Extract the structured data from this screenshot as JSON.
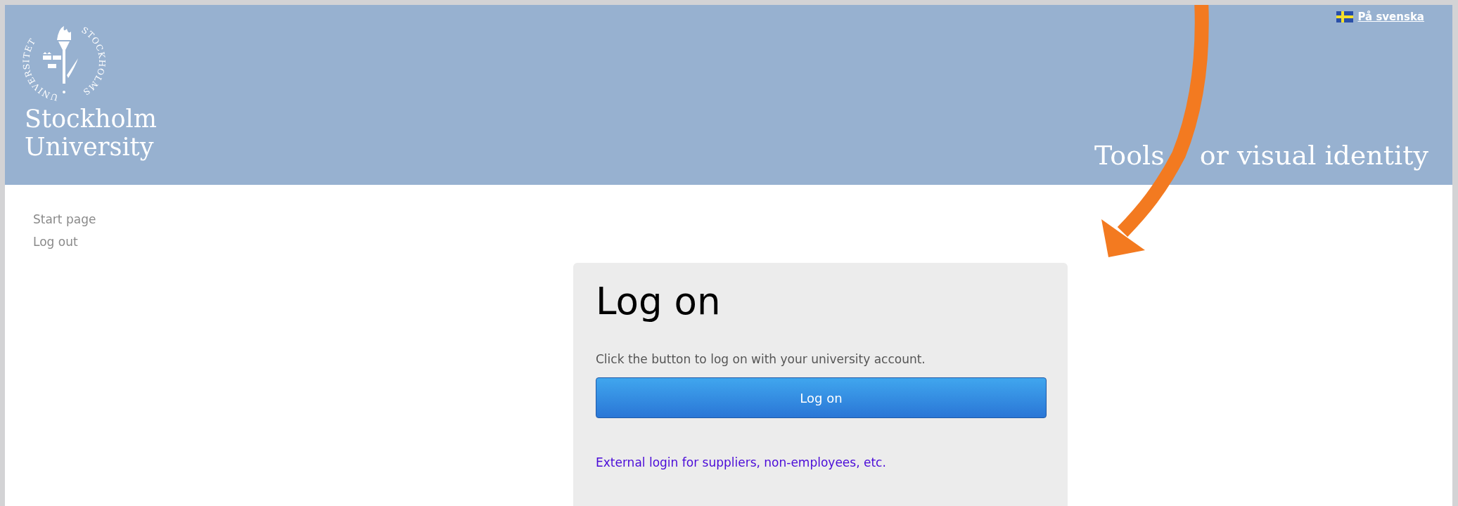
{
  "header": {
    "seal_text": [
      "UNIVERSITET",
      "STOCKHOLMS"
    ],
    "logo_lines": [
      "Stockholm",
      "University"
    ],
    "language_link": "På svenska",
    "site_title": [
      "Tools",
      "or visual identity"
    ]
  },
  "nav": [
    {
      "label": "Start page"
    },
    {
      "label": "Log out"
    }
  ],
  "login": {
    "heading": "Log on",
    "text": "Click the button to log on with your university account.",
    "button": "Log on",
    "external_link": "External login for suppliers, non-employees, etc."
  }
}
